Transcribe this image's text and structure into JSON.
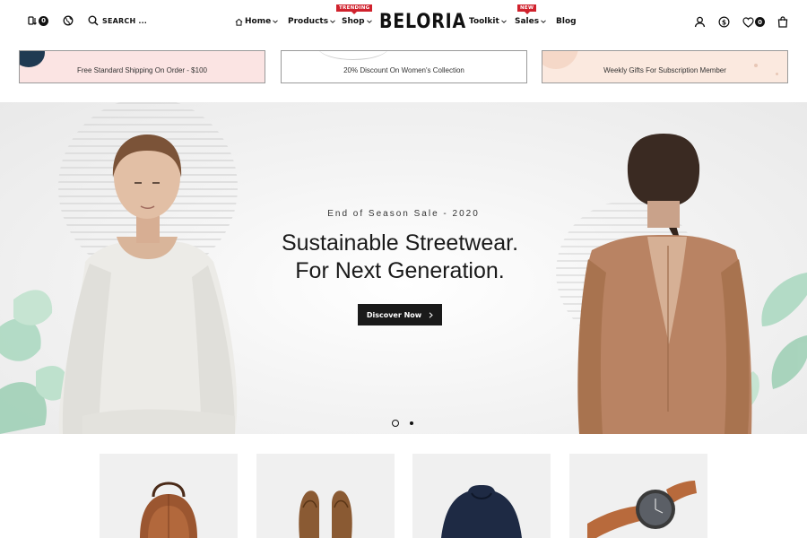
{
  "header": {
    "compare_count": "0",
    "search_label": "SEARCH ...",
    "logo_text": "BELORIA",
    "nav": [
      {
        "label": "Home",
        "has_dropdown": true,
        "icon": "home-icon"
      },
      {
        "label": "Products",
        "has_dropdown": true
      },
      {
        "label": "Shop",
        "has_dropdown": true,
        "badge": "TRENDING"
      },
      {
        "label": "Toolkit",
        "has_dropdown": true
      },
      {
        "label": "Sales",
        "has_dropdown": true,
        "badge": "NEW"
      },
      {
        "label": "Blog",
        "has_dropdown": false
      }
    ],
    "wishlist_count": "0",
    "icons": [
      "compare-icon",
      "globe-icon",
      "search-icon",
      "user-icon",
      "currency-icon",
      "heart-icon",
      "cart-icon"
    ]
  },
  "promos": [
    {
      "text": "Free Standard Shipping On Order - $100"
    },
    {
      "text": "20% Discount On Women's Collection"
    },
    {
      "text": "Weekly Gifts For Subscription Member"
    }
  ],
  "hero": {
    "eyebrow": "End of Season Sale - 2020",
    "title_line1": "Sustainable Streetwear.",
    "title_line2": "For Next Generation.",
    "cta_label": "Discover Now",
    "slide_count": 2,
    "active_slide": 1
  },
  "products": [
    {
      "image": "brown-leather-backpack"
    },
    {
      "image": "brown-leather-shoes"
    },
    {
      "image": "navy-hoodie"
    },
    {
      "image": "leather-strap-watch"
    }
  ],
  "colors": {
    "accent_badge": "#d0222d",
    "dark": "#1a1a1a",
    "promo_pink": "#fbe4e3",
    "promo_peach": "#fbe9df"
  }
}
